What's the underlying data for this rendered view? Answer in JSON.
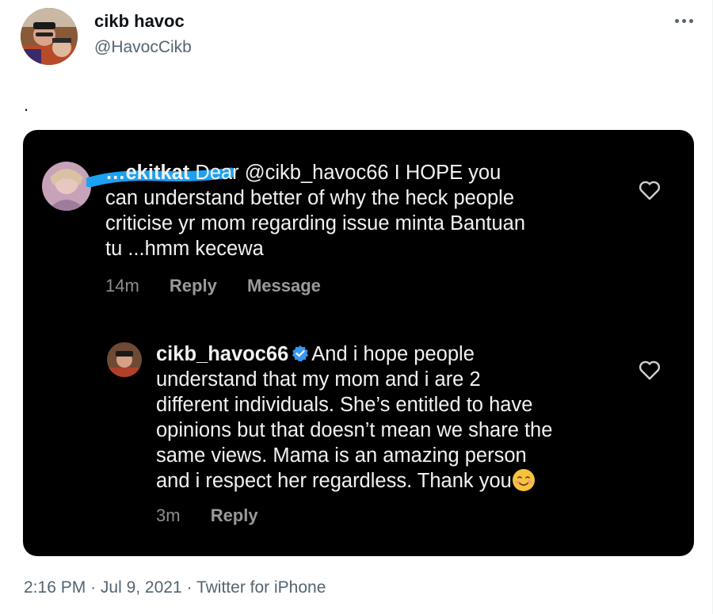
{
  "tweet": {
    "display_name": "cikb havoc",
    "handle": "@HavocCikb",
    "text": ".",
    "time": "2:16 PM",
    "separator": "·",
    "date": "Jul 9, 2021",
    "source": "Twitter for iPhone"
  },
  "icons": {
    "more": "more-horizontal-icon",
    "heart": "heart-outline-icon",
    "verified": "verified-badge-icon",
    "emoji": "smiling-face-emoji"
  },
  "colors": {
    "accent_blue": "#1da1f2",
    "verified_blue": "#3897f0",
    "card_background": "#000000",
    "muted": "#536471"
  },
  "screenshot": {
    "comment_1": {
      "username_partial": "…ekitkat",
      "text_line1": "Dear @cikb_havoc66 I HOPE you",
      "text_line2": "can understand better of why the heck people",
      "text_line3": "criticise yr mom regarding issue minta Bantuan",
      "text_line4": "tu ...hmm kecewa",
      "time": "14m",
      "reply": "Reply",
      "message": "Message"
    },
    "comment_2": {
      "username": "cikb_havoc66",
      "text_line1": "And i hope people",
      "text_line2": "understand that my mom and i are 2",
      "text_line3": "different individuals. She’s entitled to have",
      "text_line4": "opinions but that doesn’t mean we share the",
      "text_line5": "same views. Mama is an amazing person",
      "text_line6": "and i respect her regardless. Thank you",
      "time": "3m",
      "reply": "Reply"
    }
  }
}
